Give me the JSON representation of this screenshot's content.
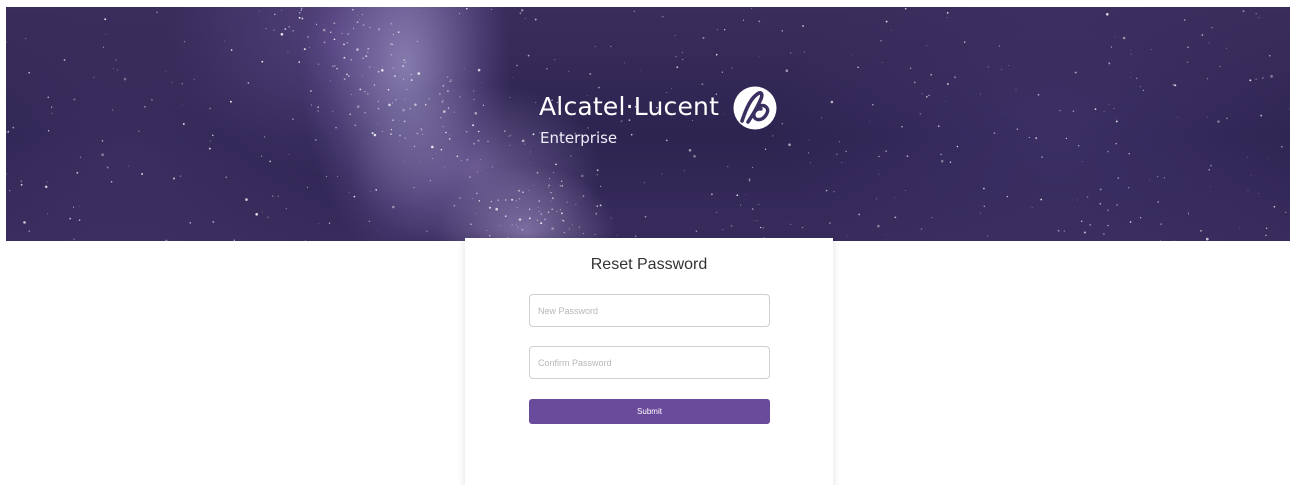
{
  "brand": {
    "name": "Alcatel·Lucent",
    "subtitle": "Enterprise",
    "logo_icon": "alcatel-lucent-logo-icon"
  },
  "reset_form": {
    "title": "Reset Password",
    "new_password": {
      "placeholder": "New Password",
      "value": ""
    },
    "confirm_password": {
      "placeholder": "Confirm Password",
      "value": ""
    },
    "submit_label": "Submit"
  },
  "colors": {
    "accent": "#6a4a9a",
    "hero_base": "#2d2450",
    "card_bg": "#ffffff"
  }
}
